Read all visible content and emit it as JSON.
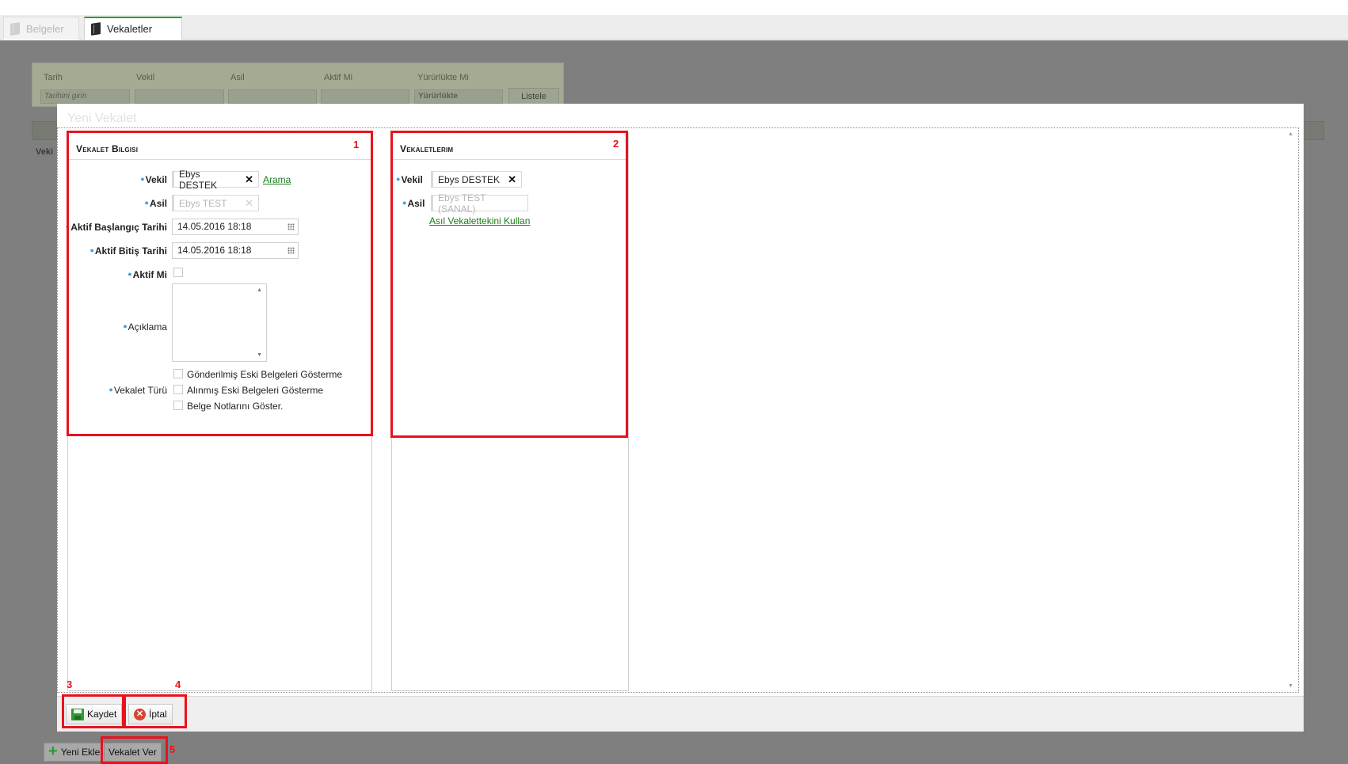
{
  "tabs": [
    {
      "label": "Belgeler",
      "active": false
    },
    {
      "label": "Vekaletler",
      "active": true
    }
  ],
  "filter": {
    "tarih_label": "Tarih",
    "tarih_placeholder": "Tarihini girin",
    "vekil_label": "Vekil",
    "asil_label": "Asil",
    "aktif_label": "Aktif Mi",
    "yururlukte_label": "Yürürlükte Mi",
    "yururlukte_value": "Yürürlükte",
    "listele_label": "Listele",
    "vek_short": "Veki"
  },
  "modal": {
    "title": "Yeni Vekalet",
    "panel1": {
      "title": "Vekalet Bilgisi",
      "vekil_label": "Vekil",
      "vekil_value": "Ebys DESTEK",
      "arama_link": "Arama",
      "asil_label": "Asil",
      "asil_value": "Ebys TEST",
      "baslangic_label": "Aktif Başlangıç Tarihi",
      "baslangic_value": "14.05.2016 18:18",
      "bitis_label": "Aktif Bitiş Tarihi",
      "bitis_value": "14.05.2016 18:18",
      "aktif_label": "Aktif Mi",
      "aciklama_label": "Açıklama",
      "vekalet_turu_label": "Vekalet Türü",
      "options": [
        "Gönderilmiş Eski Belgeleri Gösterme",
        "Alınmış Eski Belgeleri Gösterme",
        "Belge Notlarını Göster."
      ]
    },
    "panel2": {
      "title": "Vekaletlerim",
      "vekil_label": "Vekil",
      "vekil_value": "Ebys DESTEK",
      "asil_label": "Asil",
      "asil_value": "Ebys TEST (SANAL)",
      "asil_link": "Asıl Vekalettekini Kullan"
    },
    "buttons": {
      "kaydet": "Kaydet",
      "iptal": "İptal"
    }
  },
  "page_buttons": {
    "yeni_ekle": "Yeni Ekle",
    "vekalet_ver": "Vekalet Ver"
  },
  "annotations": [
    "1",
    "2",
    "3",
    "4",
    "5"
  ],
  "colors": {
    "accent_green": "#2e9b2e",
    "annotation_red": "#e8121f",
    "required_dot": "#3ca0e6"
  }
}
